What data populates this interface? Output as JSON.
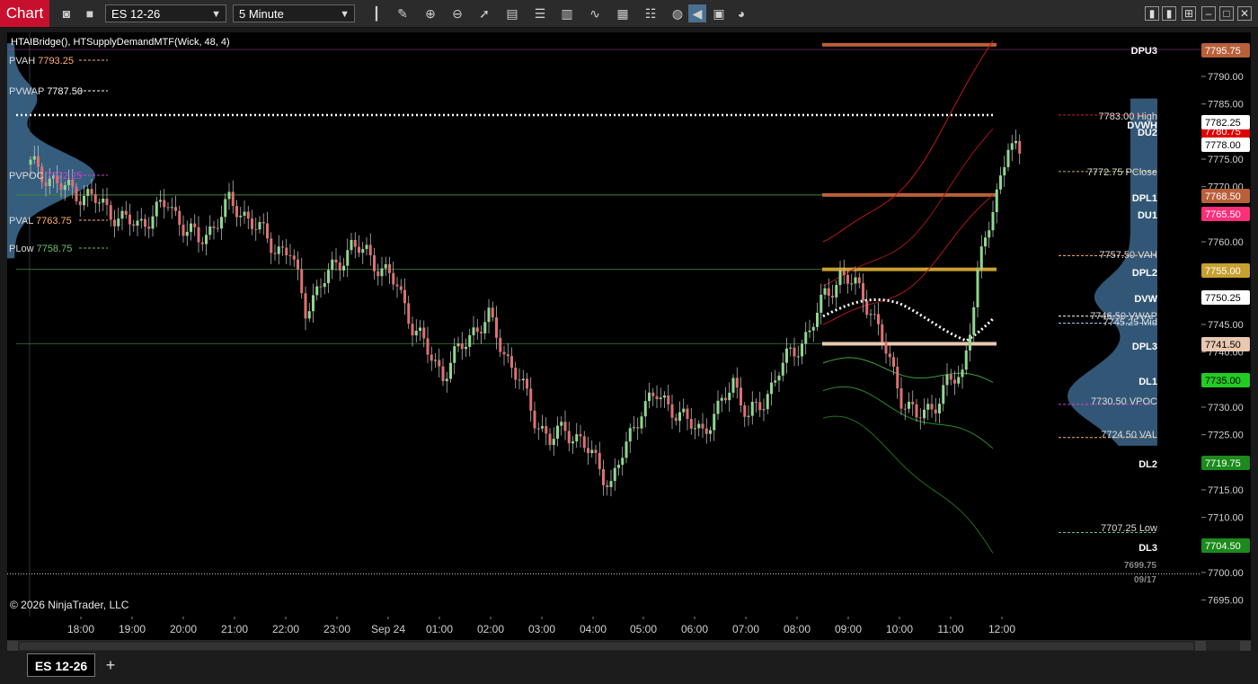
{
  "toolbar": {
    "chart_label": "Chart",
    "instrument": "ES 12-26",
    "interval": "5 Minute",
    "icons": [
      "camera-icon",
      "template-icon",
      "bars-icon",
      "draw-icon",
      "zoom-in-icon",
      "zoom-out-icon",
      "cursor-icon",
      "data-box-icon",
      "lines-icon",
      "strategies-icon",
      "indicators-icon",
      "chart-trader-icon",
      "properties-icon",
      "color-wheel-icon",
      "link-icon",
      "window-link-icon",
      "globe-icon"
    ],
    "window_controls": [
      "tile-icon",
      "tile-2-icon",
      "grid-icon",
      "minimize-icon",
      "maximize-icon",
      "close-icon"
    ]
  },
  "chart": {
    "indicator_label": "HTAIBridge(), HTSupplyDemandMTF(Wick, 48, 4)",
    "copyright": "© 2026 NinjaTrader, LLC",
    "last_close_label": "7699.75",
    "session_date_label": "09/17"
  },
  "chart_data": {
    "type": "candlestick",
    "instrument": "ES 12-26",
    "interval": "5 Minute",
    "ylim": [
      7692,
      7798
    ],
    "price_ticks": [
      "7795.00",
      "7790.00",
      "7785.00",
      "7780.00",
      "7775.00",
      "7770.00",
      "7765.00",
      "7760.00",
      "7755.00",
      "7750.00",
      "7745.00",
      "7740.00",
      "7735.00",
      "7730.00",
      "7725.00",
      "7720.00",
      "7715.00",
      "7710.00",
      "7705.00",
      "7700.00",
      "7695.00"
    ],
    "time_ticks": [
      "18:00",
      "19:00",
      "20:00",
      "21:00",
      "22:00",
      "23:00",
      "Sep 24",
      "01:00",
      "02:00",
      "03:00",
      "04:00",
      "05:00",
      "06:00",
      "07:00",
      "08:00",
      "09:00",
      "10:00",
      "11:00",
      "12:00"
    ],
    "close_path": [
      [
        0,
        7774
      ],
      [
        4,
        7772
      ],
      [
        8,
        7770
      ],
      [
        12,
        7769
      ],
      [
        16,
        7768
      ],
      [
        20,
        7766
      ],
      [
        24,
        7764
      ],
      [
        28,
        7763
      ],
      [
        32,
        7765
      ],
      [
        36,
        7767
      ],
      [
        40,
        7763
      ],
      [
        44,
        7760
      ],
      [
        48,
        7763
      ],
      [
        52,
        7767
      ],
      [
        56,
        7765
      ],
      [
        60,
        7762
      ],
      [
        64,
        7759
      ],
      [
        68,
        7758
      ],
      [
        72,
        7748
      ],
      [
        76,
        7752
      ],
      [
        80,
        7756
      ],
      [
        84,
        7759
      ],
      [
        88,
        7758
      ],
      [
        92,
        7755
      ],
      [
        96,
        7752
      ],
      [
        100,
        7745
      ],
      [
        104,
        7740
      ],
      [
        108,
        7736
      ],
      [
        112,
        7740
      ],
      [
        116,
        7744
      ],
      [
        120,
        7746
      ],
      [
        124,
        7740
      ],
      [
        128,
        7735
      ],
      [
        132,
        7728
      ],
      [
        136,
        7724
      ],
      [
        140,
        7726
      ],
      [
        144,
        7724
      ],
      [
        148,
        7720
      ],
      [
        152,
        7716
      ],
      [
        156,
        7723
      ],
      [
        160,
        7730
      ],
      [
        164,
        7732
      ],
      [
        168,
        7730
      ],
      [
        172,
        7727
      ],
      [
        176,
        7726
      ],
      [
        180,
        7729
      ],
      [
        184,
        7735
      ],
      [
        188,
        7728
      ],
      [
        192,
        7731
      ],
      [
        196,
        7737
      ],
      [
        200,
        7740
      ],
      [
        204,
        7744
      ],
      [
        208,
        7750
      ],
      [
        212,
        7754
      ],
      [
        216,
        7752
      ],
      [
        220,
        7748
      ],
      [
        224,
        7740
      ],
      [
        228,
        7732
      ],
      [
        232,
        7728
      ],
      [
        236,
        7730
      ],
      [
        240,
        7734
      ],
      [
        244,
        7736
      ],
      [
        248,
        7754
      ],
      [
        252,
        7766
      ],
      [
        256,
        7778
      ],
      [
        259,
        7775
      ]
    ],
    "left_profile_labels": [
      {
        "label": "PVAH",
        "value": "7793.25",
        "color": "#ffb070"
      },
      {
        "label": "PVWAP",
        "value": "7787.50",
        "color": "#ffffff"
      },
      {
        "label": "PVPOC",
        "value": "7772.25",
        "color": "#cc44cc"
      },
      {
        "label": "PVAL",
        "value": "7763.75",
        "color": "#ffb070"
      },
      {
        "label": "PLow",
        "value": "7758.75",
        "color": "#6fbf6f"
      }
    ],
    "levels": [
      {
        "label": "DPU3",
        "price": 7795.75,
        "price_label": "7795.75",
        "color": "#b8603a"
      },
      {
        "label": "DVWH",
        "price": 7783.0,
        "price_label": "",
        "color": "#ffffff"
      },
      {
        "label": "DU2",
        "price": 7780.75,
        "price_label": "7780.75",
        "color": "#e00000"
      },
      {
        "label": "DPL1",
        "price": 7768.5,
        "price_label": "7768.50",
        "color": "#b8603a"
      },
      {
        "label": "DU1",
        "price": 7765.5,
        "price_label": "7765.50",
        "color": "#ff2d7a"
      },
      {
        "label": "DPL2",
        "price": 7755.0,
        "price_label": "7755.00",
        "color": "#c8a030"
      },
      {
        "label": "DVW",
        "price": 7750.25,
        "price_label": "7750.25",
        "color": "#ffffff"
      },
      {
        "label": "DPL3",
        "price": 7741.5,
        "price_label": "7741.50",
        "color": "#e8c8b0"
      },
      {
        "label": "DL1",
        "price": 7735.0,
        "price_label": "7735.00",
        "color": "#22cc22"
      },
      {
        "label": "DL2",
        "price": 7719.75,
        "price_label": "7719.75",
        "color": "#1c8a1c"
      },
      {
        "label": "DL3",
        "price": 7704.5,
        "price_label": "7704.50",
        "color": "#1c8a1c"
      }
    ],
    "current_price": {
      "value": 7782.25,
      "label": "7782.25"
    },
    "last_price": {
      "value": 7778.0,
      "label": "7778.00"
    },
    "session_levels": [
      {
        "value": "7783.00",
        "label": "High",
        "price": 7783.0,
        "color": "#cc2222"
      },
      {
        "value": "7772.75",
        "label": "PClose",
        "price": 7772.75,
        "color": "#c8a850"
      },
      {
        "value": "7757.50",
        "label": "VAH",
        "price": 7757.5,
        "color": "#ffb070"
      },
      {
        "value": "7746.50",
        "label": "VWAP",
        "price": 7746.5,
        "color": "#ffffff"
      },
      {
        "value": "7745.25",
        "label": "Mid",
        "price": 7745.25,
        "color": "#9ad0ff"
      },
      {
        "value": "7730.50",
        "label": "VPOC",
        "price": 7730.5,
        "color": "#cc44cc"
      },
      {
        "value": "7724.50",
        "label": "VAL",
        "price": 7724.5,
        "color": "#ffb070"
      },
      {
        "value": "7707.25",
        "label": "Low",
        "price": 7707.25,
        "color": "#6fbf6f"
      }
    ],
    "colors": {
      "up": "#8fd88f",
      "down": "#e07070",
      "background": "#000000",
      "profile": "#3e6d93"
    }
  },
  "bottom": {
    "tab_label": "ES 12-26",
    "add_label": "+"
  }
}
